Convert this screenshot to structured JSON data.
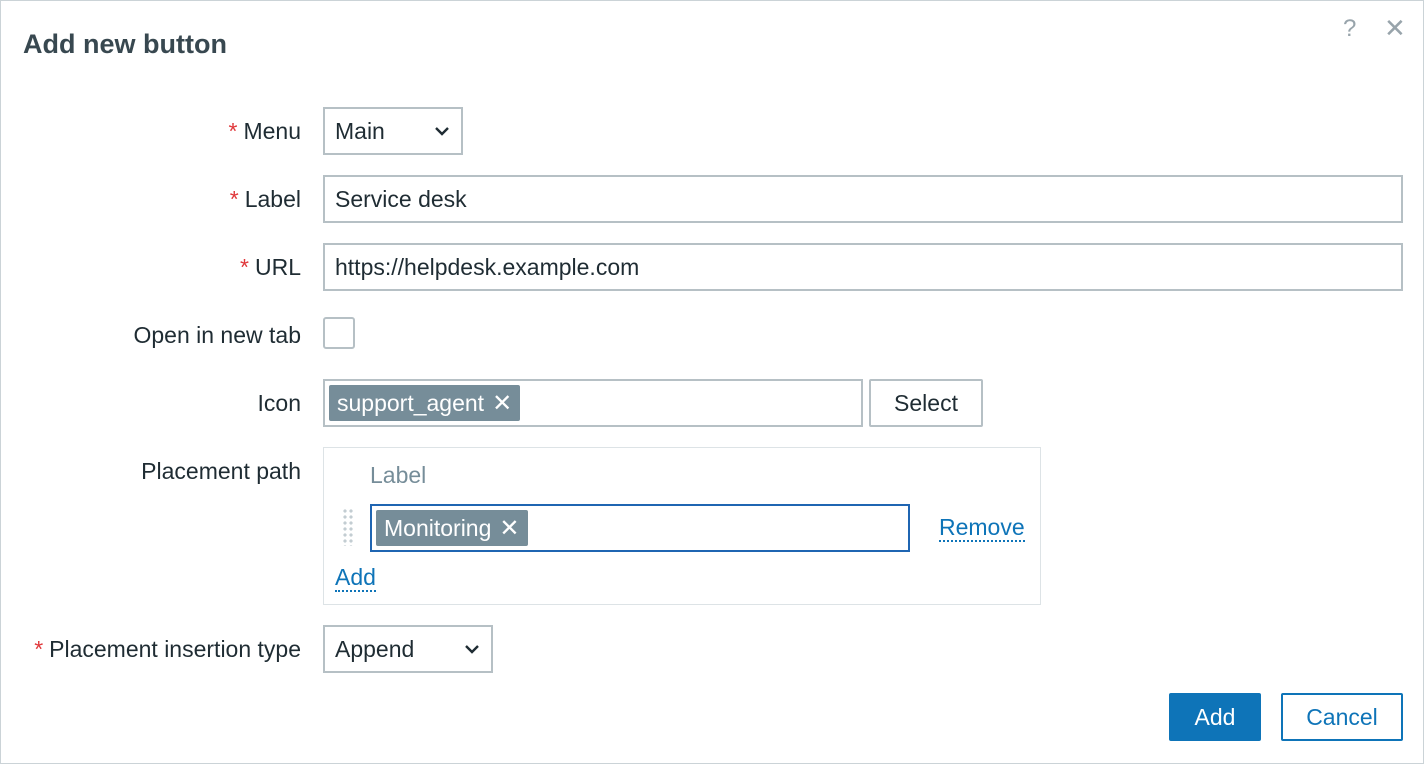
{
  "dialog": {
    "title": "Add new button",
    "help_glyph": "?",
    "close_glyph": "✕"
  },
  "form": {
    "menu": {
      "label": "Menu",
      "required": true,
      "value": "Main"
    },
    "label": {
      "label": "Label",
      "required": true,
      "value": "Service desk"
    },
    "url": {
      "label": "URL",
      "required": true,
      "value": "https://helpdesk.example.com"
    },
    "open_in_new_tab": {
      "label": "Open in new tab",
      "checked": false
    },
    "icon": {
      "label": "Icon",
      "tag": "support_agent",
      "tag_remove": "✕",
      "select_label": "Select"
    },
    "placement_path": {
      "label": "Placement path",
      "column_header": "Label",
      "rows": [
        {
          "tag": "Monitoring",
          "tag_remove": "✕",
          "remove_label": "Remove"
        }
      ],
      "add_label": "Add"
    },
    "insertion_type": {
      "label": "Placement insertion type",
      "required": true,
      "value": "Append"
    },
    "required_mark": "*"
  },
  "footer": {
    "add_label": "Add",
    "cancel_label": "Cancel"
  },
  "colors": {
    "accent": "#0e74b8",
    "required": "#e0383b",
    "tag_bg": "#768d99",
    "border": "#b6c0c5"
  },
  "icons": [
    "help-icon",
    "close-icon",
    "chevron-down-icon",
    "drag-handle-icon",
    "tag-remove-icon"
  ]
}
